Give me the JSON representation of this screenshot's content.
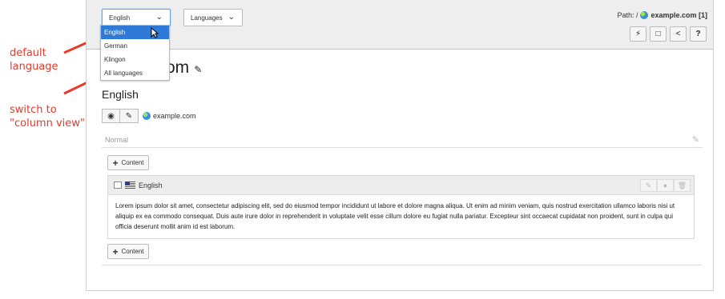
{
  "annotations": {
    "default_language": [
      "default",
      "language"
    ],
    "column_view": [
      "switch to",
      "\"column view\""
    ]
  },
  "header": {
    "language_select": {
      "value": "English"
    },
    "view_select": {
      "value": "Languages"
    },
    "language_options": [
      "English",
      "German",
      "Klingon",
      "All languages"
    ],
    "path_label": "Path: /",
    "path_site": "example.com [1]",
    "icons": [
      "lightning-icon",
      "note-icon",
      "share-icon",
      "help-icon"
    ]
  },
  "page": {
    "title_partial": "om",
    "language_heading": "English",
    "site_name": "example.com",
    "column_label": "Normal",
    "add_content_label": "Content"
  },
  "content_element": {
    "header_label": "English",
    "body": "Lorem ipsum dolor sit amet, consectetur adipiscing elit, sed do eiusmod tempor incididunt ut labore et dolore magna aliqua. Ut enim ad minim veniam, quis nostrud exercitation ullamco laboris nisi ut aliquip ex ea commodo consequat. Duis aute irure dolor in reprehenderit in voluptate velit esse cillum dolore eu fugiat nulla pariatur. Excepteur sint occaecat cupidatat non proident, sunt in culpa qui officia deserunt mollit anim id est laborum."
  },
  "colors": {
    "annotation": "#e8392b",
    "selected_option": "#2e7ad6"
  }
}
